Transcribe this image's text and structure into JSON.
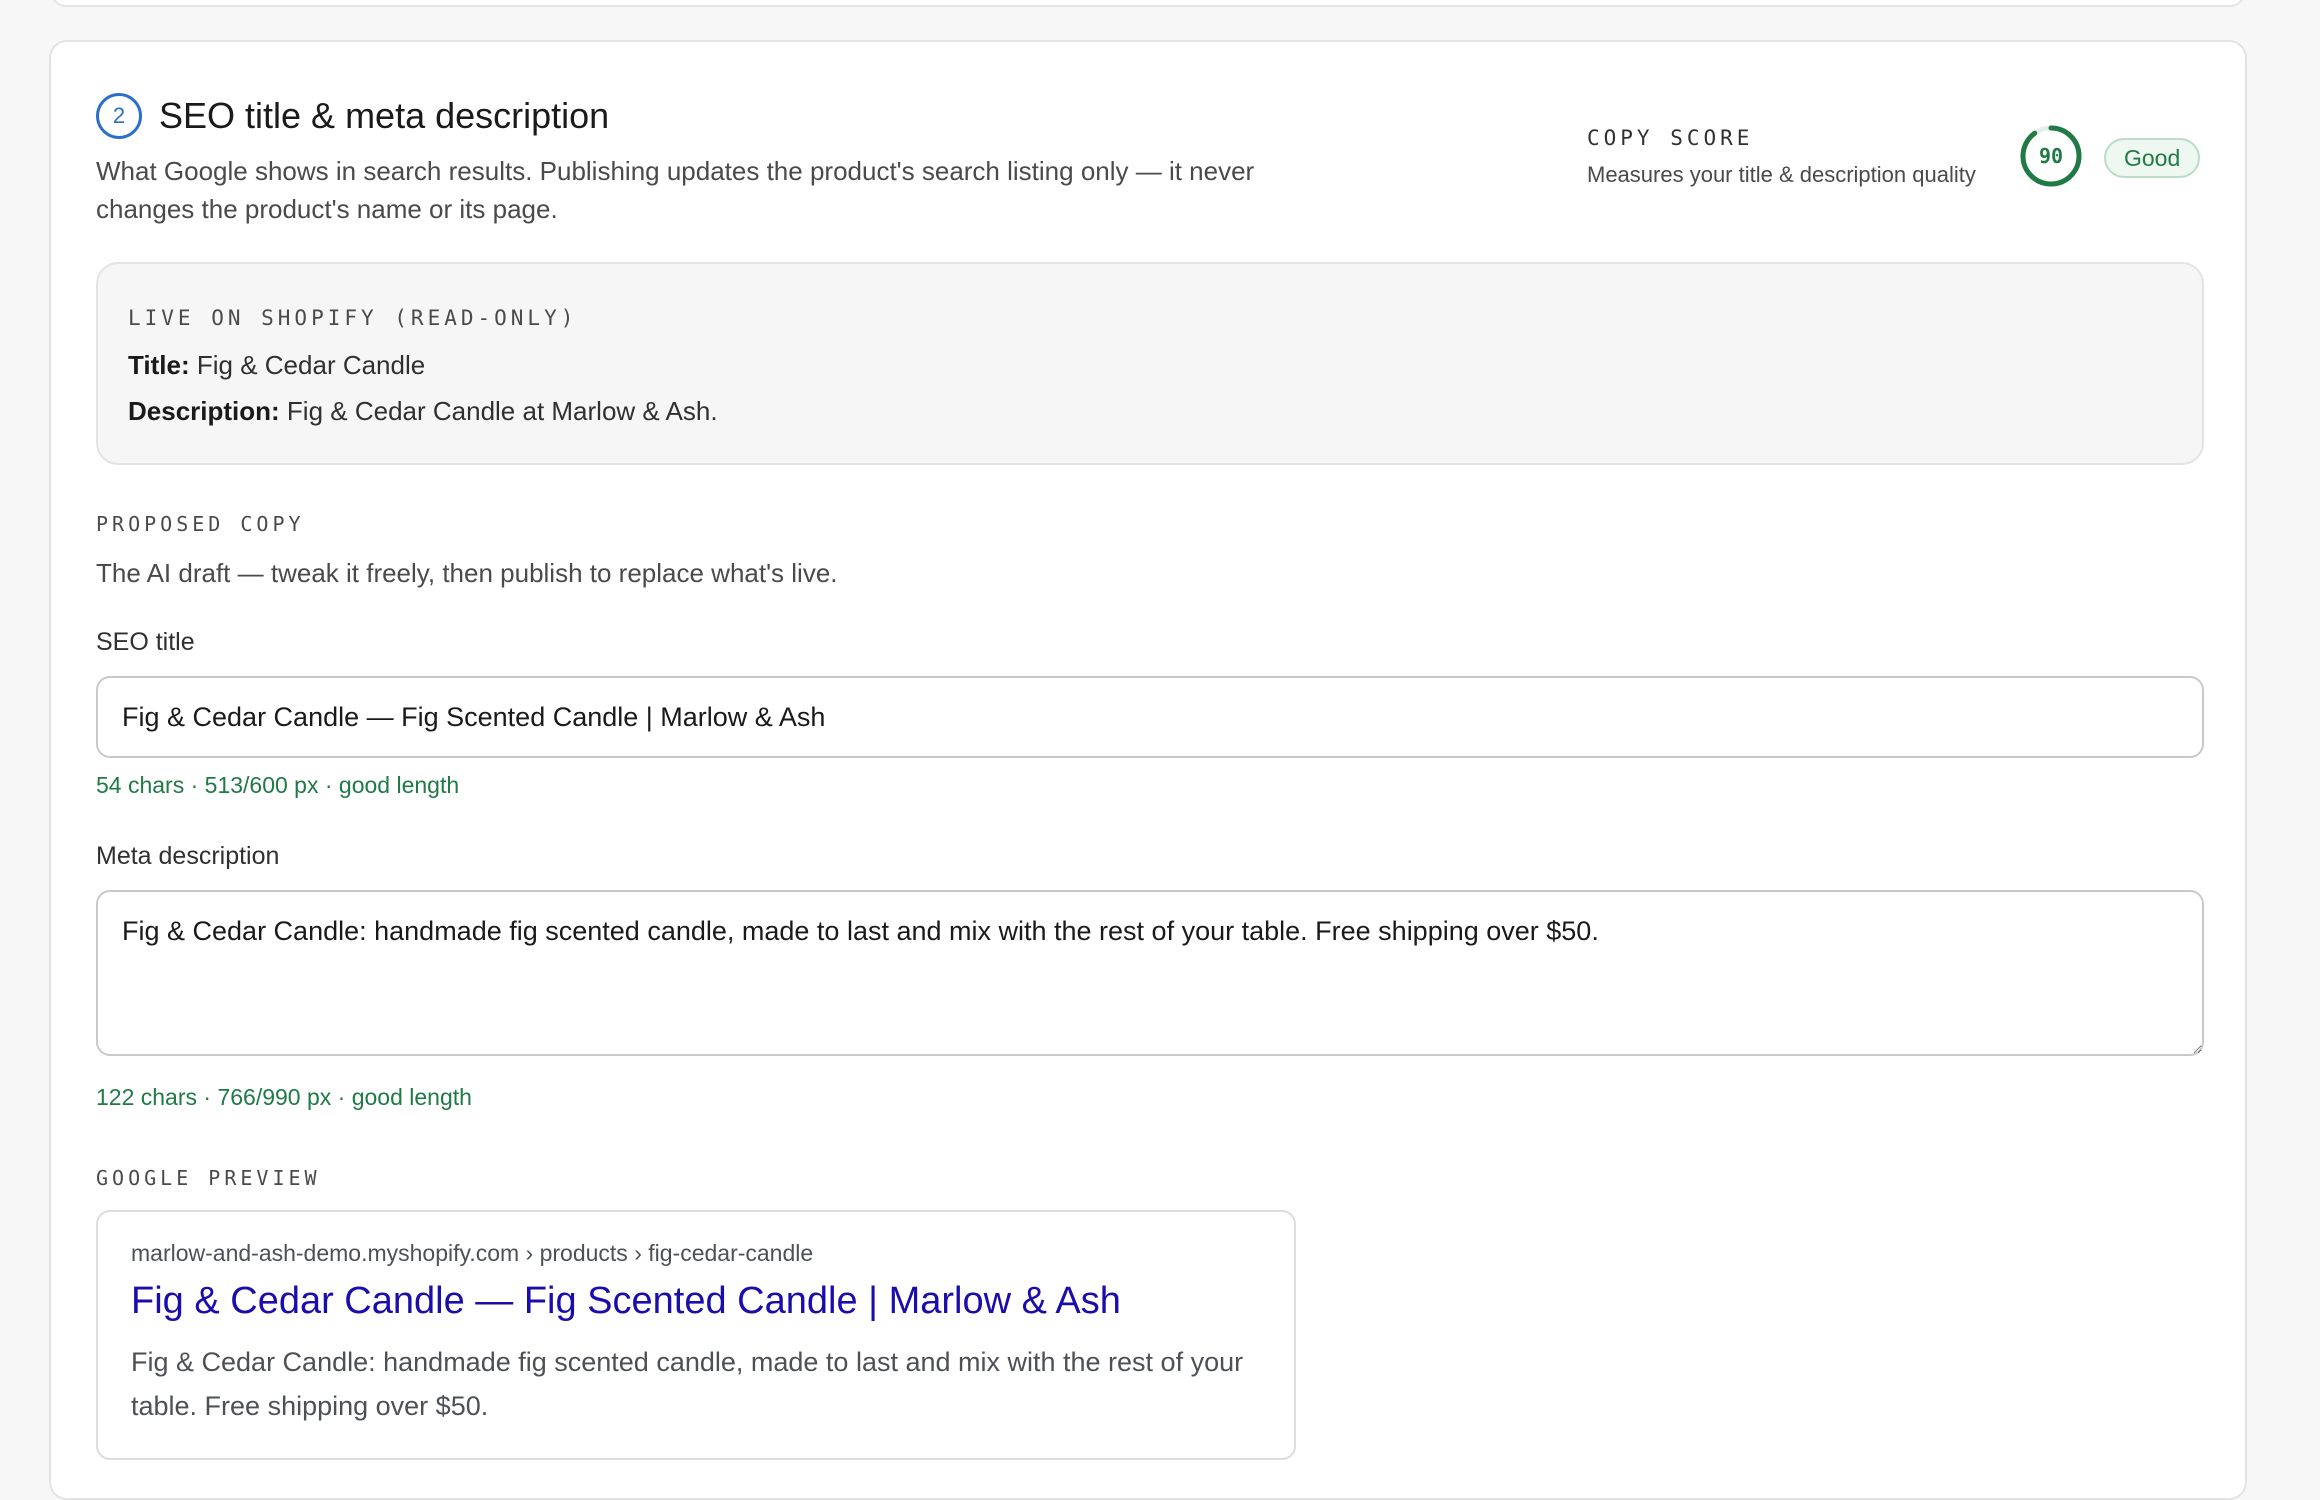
{
  "section": {
    "step_number": "2",
    "title": "SEO title & meta description",
    "subtitle": "What Google shows in search results. Publishing updates the product's search listing only — it never changes the product's name or its page."
  },
  "copy_score": {
    "label": "COPY SCORE",
    "description": "Measures your title & description quality",
    "value": "90",
    "percent": 90,
    "rating": "Good",
    "color": "#1f7a46"
  },
  "live": {
    "label": "LIVE ON SHOPIFY (READ-ONLY)",
    "title_label": "Title:",
    "title_value": "Fig & Cedar Candle",
    "description_label": "Description:",
    "description_value": "Fig & Cedar Candle at Marlow & Ash."
  },
  "proposed": {
    "label": "PROPOSED COPY",
    "helper": "The AI draft — tweak it freely, then publish to replace what's live.",
    "seo_title_label": "SEO title",
    "seo_title_value": "Fig & Cedar Candle — Fig Scented Candle | Marlow & Ash",
    "seo_title_meta": "54 chars · 513/600 px · good length",
    "meta_description_label": "Meta description",
    "meta_description_value": "Fig & Cedar Candle: handmade fig scented candle, made to last and mix with the rest of your table. Free shipping over $50.",
    "meta_description_meta": "122 chars · 766/990 px · good length"
  },
  "google_preview": {
    "label": "GOOGLE PREVIEW",
    "url": "marlow-and-ash-demo.myshopify.com › products › fig-cedar-candle",
    "title": "Fig & Cedar Candle — Fig Scented Candle | Marlow & Ash",
    "description": "Fig & Cedar Candle: handmade fig scented candle, made to last and mix with the rest of your table. Free shipping over $50."
  },
  "colors": {
    "accent_blue": "#2c6ecb",
    "success_green": "#1f7a46",
    "google_link": "#1a0dab"
  }
}
